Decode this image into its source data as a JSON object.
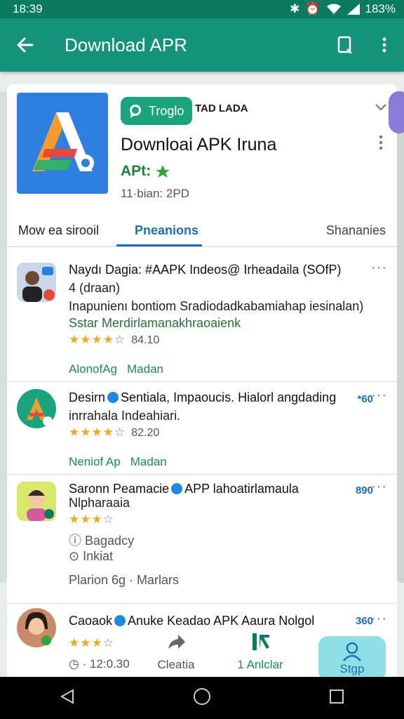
{
  "status_bar": {
    "time": "18:39",
    "battery": "183%"
  },
  "app_bar": {
    "title": "Download APR"
  },
  "hero": {
    "chip_label": "Troglo",
    "chip_side": "TAD LADA",
    "title": "Downloai APK Iruna",
    "subtitle": "APt:",
    "meta": "11·bian: 2PD"
  },
  "tabs": [
    {
      "label": "Mow ea sirooil"
    },
    {
      "label": "Pneanions"
    },
    {
      "label": "Shananies"
    }
  ],
  "posts": [
    {
      "title": "Naydı Dagia: #AAPK Indeos@ Irheadaila (SOfP)",
      "line2": "4 (draan)",
      "line3": "Inapunienı bontiom Sradiodadkabamiahap iesinalan)",
      "line4": "Sstar Merdirlamanakhraoaienk",
      "rating": "84.10",
      "foot1": "AlonofAg",
      "foot2": "Madan",
      "more": "···"
    },
    {
      "title_a": "Desirn",
      "title_b": "Sentiala, Impaoucis. Hialorl angdading",
      "tag": "*60",
      "line2": "inrrahala Indeahiari.",
      "rating": "82.20",
      "foot1": "Neniof Ap",
      "foot2": "Madan",
      "more": "···"
    },
    {
      "title_a": "Saronn Peamacie",
      "title_b": "APP lahoatirlamaula",
      "line1b": "Nlpharaaia",
      "tag": "890",
      "meta1": "Bagadcy",
      "meta2": "Inkiat",
      "foot": "Plarion 6g · Marlars",
      "more": "···"
    },
    {
      "title_a": "Caoaok",
      "title_b": "Anuke Keadao APK Aaura Nolgol",
      "tag": "360",
      "more": "···"
    }
  ],
  "bottom_actions": {
    "time": "· 12:0.30",
    "share": "Cleatia",
    "download": "1 Anlclar",
    "stop": "Stgp"
  }
}
